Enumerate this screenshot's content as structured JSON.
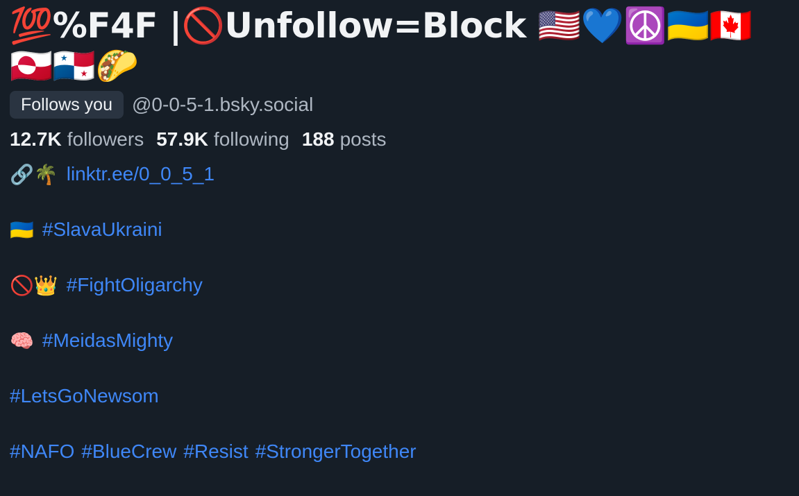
{
  "profile": {
    "display_name": "💯%F4F |🚫Unfollow=Block 🇺🇸💙☮️🇺🇦🇨🇦🇬🇱🇵🇦🌮",
    "follows_you_badge": "Follows you",
    "handle": "@0-0-5-1.bsky.social"
  },
  "stats": {
    "followers_count": "12.7K",
    "followers_label": "followers",
    "following_count": "57.9K",
    "following_label": "following",
    "posts_count": "188",
    "posts_label": "posts"
  },
  "bio": {
    "line1_emoji": "🔗🌴",
    "line1_link": "linktr.ee/0_0_5_1",
    "line2_emoji": "🇺🇦",
    "line2_tag": "#SlavaUkraini",
    "line3_emoji": "🚫👑",
    "line3_tag": "#FightOligarchy",
    "line4_emoji": "🧠",
    "line4_tag": "#MeidasMighty",
    "line5_tag": "#LetsGoNewsom",
    "line6_tags": [
      "#NAFO",
      "#BlueCrew",
      "#Resist",
      "#StrongerTogether"
    ]
  }
}
